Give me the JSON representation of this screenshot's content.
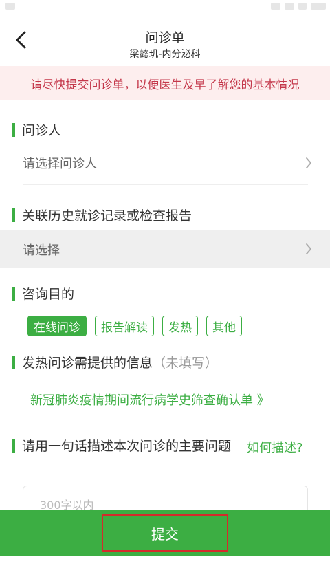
{
  "header": {
    "title": "问诊单",
    "subtitle": "梁懿玑-内分泌科"
  },
  "notice": "请尽快提交问诊单，以便医生及早了解您的基本情况",
  "patient": {
    "title": "问诊人",
    "placeholder": "请选择问诊人"
  },
  "history": {
    "title": "关联历史就诊记录或检查报告",
    "placeholder": "请选择"
  },
  "purpose": {
    "title": "咨询目的",
    "tags": [
      {
        "label": "在线问诊",
        "active": true
      },
      {
        "label": "报告解读",
        "active": false
      },
      {
        "label": "发热",
        "active": false
      },
      {
        "label": "其他",
        "active": false
      }
    ]
  },
  "fever": {
    "title": "发热问诊需提供的信息",
    "status": "（未填写）",
    "link": "新冠肺炎疫情期间流行病学史筛查确认单 》"
  },
  "description": {
    "title": "请用一句话描述本次问诊的主要问题",
    "how_link": "如何描述?",
    "placeholder": "300字以内"
  },
  "submit_label": "提交",
  "colors": {
    "accent": "#3cae43",
    "notice_bg": "#fdeeee",
    "notice_text": "#c4374a",
    "highlight_border": "#d42b2b"
  }
}
